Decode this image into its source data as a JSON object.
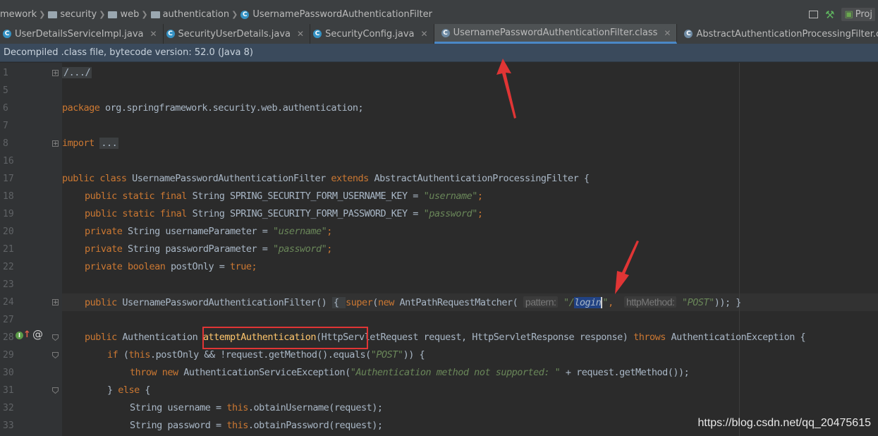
{
  "breadcrumb": {
    "items": [
      "mework",
      "security",
      "web",
      "authentication",
      "UsernamePasswordAuthenticationFilter"
    ],
    "project_label": "Proj"
  },
  "tabs": [
    {
      "label": "UserDetailsServiceImpl.java",
      "active": false
    },
    {
      "label": "SecurityUserDetails.java",
      "active": false
    },
    {
      "label": "SecurityConfig.java",
      "active": false
    },
    {
      "label": "UsernamePasswordAuthenticationFilter.class",
      "active": true
    },
    {
      "label": "AbstractAuthenticationProcessingFilter.class",
      "active": false
    }
  ],
  "banner": {
    "text": "Decompiled .class file, bytecode version: 52.0 (Java 8)"
  },
  "editor": {
    "line_numbers": [
      "1",
      "5",
      "6",
      "7",
      "8",
      "16",
      "17",
      "18",
      "19",
      "20",
      "21",
      "22",
      "23",
      "24",
      "27",
      "28",
      "29",
      "30",
      "31",
      "32",
      "33"
    ],
    "lines": {
      "l1": "/.../",
      "l6_kw": "package",
      "l6_rest": " org.springframework.security.web.authentication;",
      "l8_kw": "import",
      "l8_fold": "...",
      "l17_kw1": "public class",
      "l17_name": " UsernamePasswordAuthenticationFilter ",
      "l17_kw2": "extends",
      "l17_rest": " AbstractAuthenticationProcessingFilter {",
      "l18_kw": "public static final",
      "l18_rest": " String SPRING_SECURITY_FORM_USERNAME_KEY = ",
      "l18_str": "\"username\"",
      "l19_kw": "public static final",
      "l19_rest": " String SPRING_SECURITY_FORM_PASSWORD_KEY = ",
      "l19_str": "\"password\"",
      "l20_kw": "private",
      "l20_rest": " String usernameParameter = ",
      "l20_str": "\"username\"",
      "l21_kw": "private",
      "l21_rest": " String passwordParameter = ",
      "l21_str": "\"password\"",
      "l22_kw": "private boolean",
      "l22_rest": " postOnly = ",
      "l22_val": "true",
      "l24_kw": "public",
      "l24_rest": " UsernamePasswordAuthenticationFilter() ",
      "l24_brace": "{ ",
      "l24_super": "super",
      "l24_paren": "(",
      "l24_new": "new",
      "l24_matcher": " AntPathRequestMatcher( ",
      "l24_hint1": "pattern:",
      "l24_str1a": " \"/",
      "l24_sel": "login",
      "l24_str1b": "\"",
      "l24_comma": ",  ",
      "l24_hint2": "httpMethod:",
      "l24_str2": " \"POST\"",
      "l24_end": ")); }",
      "l28_kw": "public",
      "l28_rest1": " Authentication ",
      "l28_method": "attemptAuthentication",
      "l28_rest2": "(HttpServletRequest request, HttpServletResponse response) ",
      "l28_kw2": "throws",
      "l28_rest3": " AuthenticationException {",
      "l29_kw": "if",
      "l29_a": " (",
      "l29_this": "this",
      "l29_b": ".postOnly && !request.getMethod().equals(",
      "l29_str": "\"POST\"",
      "l29_c": ")) {",
      "l30_kw": "throw new",
      "l30_a": " AuthenticationServiceException(",
      "l30_str": "\"Authentication method not supported: \"",
      "l30_b": " + request.getMethod());",
      "l31_a": "} ",
      "l31_kw": "else",
      "l31_b": " {",
      "l32_a": "String username = ",
      "l32_this": "this",
      "l32_b": ".obtainUsername(request);",
      "l33_a": "String password = ",
      "l33_this": "this",
      "l33_b": ".obtainPassword(request);"
    }
  },
  "watermark": "https://blog.csdn.net/qq_20475615",
  "colors": {
    "keyword": "#cc7832",
    "string": "#6a8759",
    "text": "#a9b7c6",
    "annotation_red": "#e03535"
  }
}
